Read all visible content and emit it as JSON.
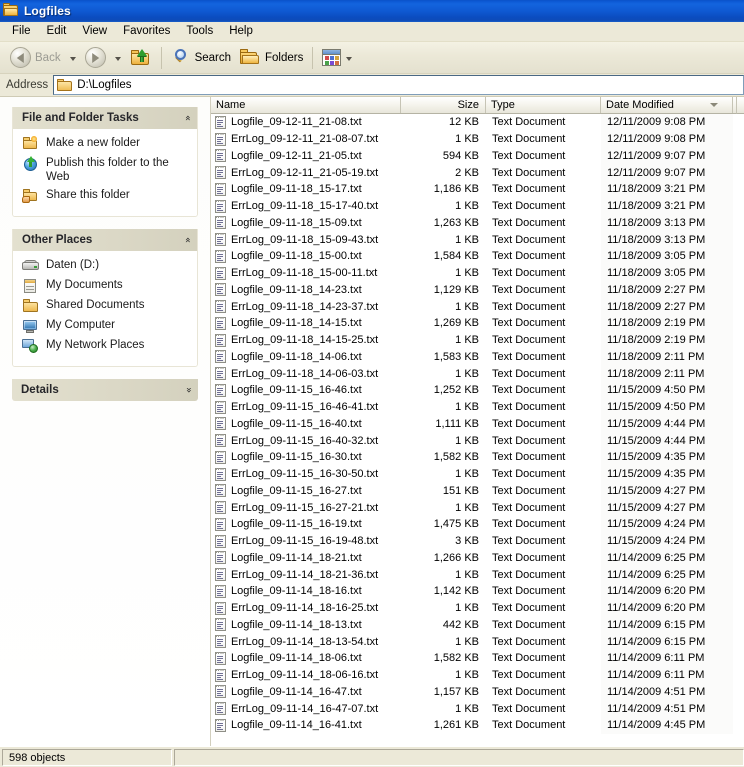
{
  "window": {
    "title": "Logfiles",
    "folder_icon": "folder-icon"
  },
  "menubar": {
    "items": [
      {
        "label": "File"
      },
      {
        "label": "Edit"
      },
      {
        "label": "View"
      },
      {
        "label": "Favorites"
      },
      {
        "label": "Tools"
      },
      {
        "label": "Help"
      }
    ]
  },
  "toolbar": {
    "back_label": "Back",
    "search_label": "Search",
    "folders_label": "Folders"
  },
  "address": {
    "label": "Address",
    "value": "D:\\Logfiles"
  },
  "sidebar": {
    "panels": [
      {
        "title": "File and Folder Tasks",
        "chevron": "«",
        "collapsed": false,
        "items": [
          {
            "label": "Make a new folder",
            "icon": "new-folder-icon"
          },
          {
            "label": "Publish this folder to the Web",
            "icon": "publish-web-icon"
          },
          {
            "label": "Share this folder",
            "icon": "share-folder-icon"
          }
        ]
      },
      {
        "title": "Other Places",
        "chevron": "«",
        "collapsed": false,
        "items": [
          {
            "label": "Daten (D:)",
            "icon": "hard-drive-icon"
          },
          {
            "label": "My Documents",
            "icon": "my-documents-icon"
          },
          {
            "label": "Shared Documents",
            "icon": "shared-documents-icon"
          },
          {
            "label": "My Computer",
            "icon": "my-computer-icon"
          },
          {
            "label": "My Network Places",
            "icon": "network-places-icon"
          }
        ]
      },
      {
        "title": "Details",
        "chevron": "»",
        "collapsed": true,
        "items": []
      }
    ]
  },
  "filelist": {
    "columns": [
      {
        "key": "name",
        "label": "Name",
        "sorted": false
      },
      {
        "key": "size",
        "label": "Size",
        "sorted": false
      },
      {
        "key": "type",
        "label": "Type",
        "sorted": false
      },
      {
        "key": "date",
        "label": "Date Modified",
        "sorted": true,
        "sort_direction": "descending"
      }
    ],
    "rows": [
      {
        "name": "Logfile_09-12-11_21-08.txt",
        "size": "12 KB",
        "type": "Text Document",
        "date": "12/11/2009 9:08 PM"
      },
      {
        "name": "ErrLog_09-12-11_21-08-07.txt",
        "size": "1 KB",
        "type": "Text Document",
        "date": "12/11/2009 9:08 PM"
      },
      {
        "name": "Logfile_09-12-11_21-05.txt",
        "size": "594 KB",
        "type": "Text Document",
        "date": "12/11/2009 9:07 PM"
      },
      {
        "name": "ErrLog_09-12-11_21-05-19.txt",
        "size": "2 KB",
        "type": "Text Document",
        "date": "12/11/2009 9:07 PM"
      },
      {
        "name": "Logfile_09-11-18_15-17.txt",
        "size": "1,186 KB",
        "type": "Text Document",
        "date": "11/18/2009 3:21 PM"
      },
      {
        "name": "ErrLog_09-11-18_15-17-40.txt",
        "size": "1 KB",
        "type": "Text Document",
        "date": "11/18/2009 3:21 PM"
      },
      {
        "name": "Logfile_09-11-18_15-09.txt",
        "size": "1,263 KB",
        "type": "Text Document",
        "date": "11/18/2009 3:13 PM"
      },
      {
        "name": "ErrLog_09-11-18_15-09-43.txt",
        "size": "1 KB",
        "type": "Text Document",
        "date": "11/18/2009 3:13 PM"
      },
      {
        "name": "Logfile_09-11-18_15-00.txt",
        "size": "1,584 KB",
        "type": "Text Document",
        "date": "11/18/2009 3:05 PM"
      },
      {
        "name": "ErrLog_09-11-18_15-00-11.txt",
        "size": "1 KB",
        "type": "Text Document",
        "date": "11/18/2009 3:05 PM"
      },
      {
        "name": "Logfile_09-11-18_14-23.txt",
        "size": "1,129 KB",
        "type": "Text Document",
        "date": "11/18/2009 2:27 PM"
      },
      {
        "name": "ErrLog_09-11-18_14-23-37.txt",
        "size": "1 KB",
        "type": "Text Document",
        "date": "11/18/2009 2:27 PM"
      },
      {
        "name": "Logfile_09-11-18_14-15.txt",
        "size": "1,269 KB",
        "type": "Text Document",
        "date": "11/18/2009 2:19 PM"
      },
      {
        "name": "ErrLog_09-11-18_14-15-25.txt",
        "size": "1 KB",
        "type": "Text Document",
        "date": "11/18/2009 2:19 PM"
      },
      {
        "name": "Logfile_09-11-18_14-06.txt",
        "size": "1,583 KB",
        "type": "Text Document",
        "date": "11/18/2009 2:11 PM"
      },
      {
        "name": "ErrLog_09-11-18_14-06-03.txt",
        "size": "1 KB",
        "type": "Text Document",
        "date": "11/18/2009 2:11 PM"
      },
      {
        "name": "Logfile_09-11-15_16-46.txt",
        "size": "1,252 KB",
        "type": "Text Document",
        "date": "11/15/2009 4:50 PM"
      },
      {
        "name": "ErrLog_09-11-15_16-46-41.txt",
        "size": "1 KB",
        "type": "Text Document",
        "date": "11/15/2009 4:50 PM"
      },
      {
        "name": "Logfile_09-11-15_16-40.txt",
        "size": "1,111 KB",
        "type": "Text Document",
        "date": "11/15/2009 4:44 PM"
      },
      {
        "name": "ErrLog_09-11-15_16-40-32.txt",
        "size": "1 KB",
        "type": "Text Document",
        "date": "11/15/2009 4:44 PM"
      },
      {
        "name": "Logfile_09-11-15_16-30.txt",
        "size": "1,582 KB",
        "type": "Text Document",
        "date": "11/15/2009 4:35 PM"
      },
      {
        "name": "ErrLog_09-11-15_16-30-50.txt",
        "size": "1 KB",
        "type": "Text Document",
        "date": "11/15/2009 4:35 PM"
      },
      {
        "name": "Logfile_09-11-15_16-27.txt",
        "size": "151 KB",
        "type": "Text Document",
        "date": "11/15/2009 4:27 PM"
      },
      {
        "name": "ErrLog_09-11-15_16-27-21.txt",
        "size": "1 KB",
        "type": "Text Document",
        "date": "11/15/2009 4:27 PM"
      },
      {
        "name": "Logfile_09-11-15_16-19.txt",
        "size": "1,475 KB",
        "type": "Text Document",
        "date": "11/15/2009 4:24 PM"
      },
      {
        "name": "ErrLog_09-11-15_16-19-48.txt",
        "size": "3 KB",
        "type": "Text Document",
        "date": "11/15/2009 4:24 PM"
      },
      {
        "name": "Logfile_09-11-14_18-21.txt",
        "size": "1,266 KB",
        "type": "Text Document",
        "date": "11/14/2009 6:25 PM"
      },
      {
        "name": "ErrLog_09-11-14_18-21-36.txt",
        "size": "1 KB",
        "type": "Text Document",
        "date": "11/14/2009 6:25 PM"
      },
      {
        "name": "Logfile_09-11-14_18-16.txt",
        "size": "1,142 KB",
        "type": "Text Document",
        "date": "11/14/2009 6:20 PM"
      },
      {
        "name": "ErrLog_09-11-14_18-16-25.txt",
        "size": "1 KB",
        "type": "Text Document",
        "date": "11/14/2009 6:20 PM"
      },
      {
        "name": "Logfile_09-11-14_18-13.txt",
        "size": "442 KB",
        "type": "Text Document",
        "date": "11/14/2009 6:15 PM"
      },
      {
        "name": "ErrLog_09-11-14_18-13-54.txt",
        "size": "1 KB",
        "type": "Text Document",
        "date": "11/14/2009 6:15 PM"
      },
      {
        "name": "Logfile_09-11-14_18-06.txt",
        "size": "1,582 KB",
        "type": "Text Document",
        "date": "11/14/2009 6:11 PM"
      },
      {
        "name": "ErrLog_09-11-14_18-06-16.txt",
        "size": "1 KB",
        "type": "Text Document",
        "date": "11/14/2009 6:11 PM"
      },
      {
        "name": "Logfile_09-11-14_16-47.txt",
        "size": "1,157 KB",
        "type": "Text Document",
        "date": "11/14/2009 4:51 PM"
      },
      {
        "name": "ErrLog_09-11-14_16-47-07.txt",
        "size": "1 KB",
        "type": "Text Document",
        "date": "11/14/2009 4:51 PM"
      },
      {
        "name": "Logfile_09-11-14_16-41.txt",
        "size": "1,261 KB",
        "type": "Text Document",
        "date": "11/14/2009 4:45 PM"
      }
    ]
  },
  "statusbar": {
    "object_count": "598 objects"
  },
  "colors": {
    "titlebar_blue": "#0d5ad6",
    "chrome_beige": "#ece9d8",
    "panel_header": "#dbd8c6",
    "list_background": "#ffffff",
    "sorted_column_tint": "#fbfbfa"
  }
}
